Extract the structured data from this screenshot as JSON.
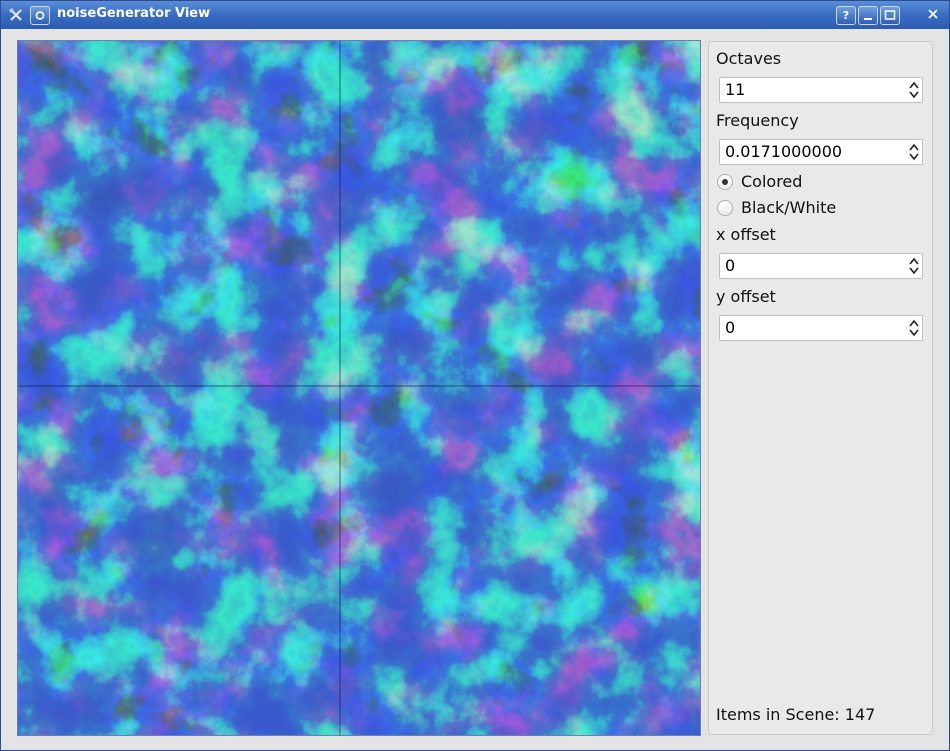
{
  "window": {
    "title": "noiseGenerator View",
    "buttons": {
      "help": "?",
      "minimize": "_",
      "maximize": "□",
      "close": "✕"
    }
  },
  "controls": {
    "octaves_label": "Octaves",
    "octaves_value": "11",
    "frequency_label": "Frequency",
    "frequency_value": "0.0171000000",
    "colored_label": "Colored",
    "colored_checked": true,
    "bw_label": "Black/White",
    "bw_checked": false,
    "xoffset_label": "x offset",
    "xoffset_value": "0",
    "yoffset_label": "y offset",
    "yoffset_value": "0"
  },
  "status": {
    "items_in_scene": "Items in Scene: 147"
  },
  "colors": {
    "deep": "#0a1a80",
    "blob": "#16329c",
    "land": "#1f9e2a",
    "rim": "#5fd0e8"
  }
}
